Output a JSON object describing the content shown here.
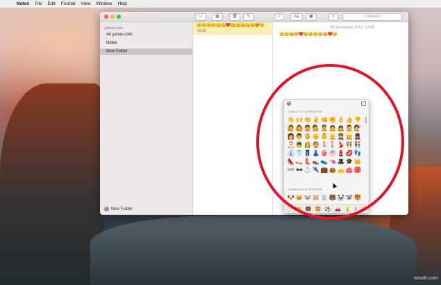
{
  "menubar": {
    "app_name": "Notes",
    "items": [
      "File",
      "Edit",
      "Format",
      "View",
      "Window",
      "Help"
    ]
  },
  "search": {
    "placeholder": "Search"
  },
  "sidebar": {
    "account": "yahoo.com",
    "items": [
      {
        "label": "All yahoo.com"
      },
      {
        "label": "Notes"
      },
      {
        "label": "New Folder",
        "selected": true
      }
    ],
    "new_folder_button": "New Folder"
  },
  "note_list": {
    "preview_emoji": "😊😊😊😊😋😋❤️😋😋😋😋😋😍😊",
    "time": "19:06"
  },
  "editor": {
    "date": "26 November 2015, 19:06",
    "body_emoji": "😊😊😊😊❤️😊😊😊😊😊❤️😊"
  },
  "emoji_picker": {
    "section1": "SMILEYS & PEOPLE",
    "section2": "ANIMALS & NATURE",
    "grid": [
      "👋",
      "🙌",
      "👏",
      "✌️",
      "👊",
      "✊",
      "👌",
      "👍",
      "👎",
      "🙋",
      "🙆",
      "🙅",
      "💁",
      "🙎",
      "🙍",
      "🙇",
      "💆",
      "💇",
      "👩",
      "👨",
      "👵",
      "👴",
      "👶",
      "👱",
      "👮",
      "👷",
      "💂",
      "🎅",
      "👼",
      "👸",
      "👰",
      "🏃",
      "🚶",
      "💃",
      "👯",
      "👫",
      "👔",
      "👕",
      "👖",
      "👗",
      "👙",
      "👘",
      "💄",
      "💋",
      "👣",
      "👠",
      "👡",
      "👢",
      "👞",
      "👟",
      "👒",
      "🎩",
      "🎓",
      "👑",
      "👓",
      "🕶",
      "💍",
      "🌂",
      "💼",
      "👜",
      "👝",
      "👛",
      "🎒"
    ],
    "grid2": [
      "🐶",
      "🐱",
      "🐭",
      "🐹",
      "🐰",
      "🐻",
      "🐼",
      "🐨",
      "🐯"
    ],
    "tabs": [
      "🕒",
      "😀",
      "🐻",
      "🍔",
      "⚽",
      "🚗",
      "💡",
      "#",
      "🏳"
    ]
  },
  "watermark": "wsxdn.com",
  "colors": {
    "highlight_circle": "#e0132b",
    "note_selected": "#fbeeb0"
  }
}
